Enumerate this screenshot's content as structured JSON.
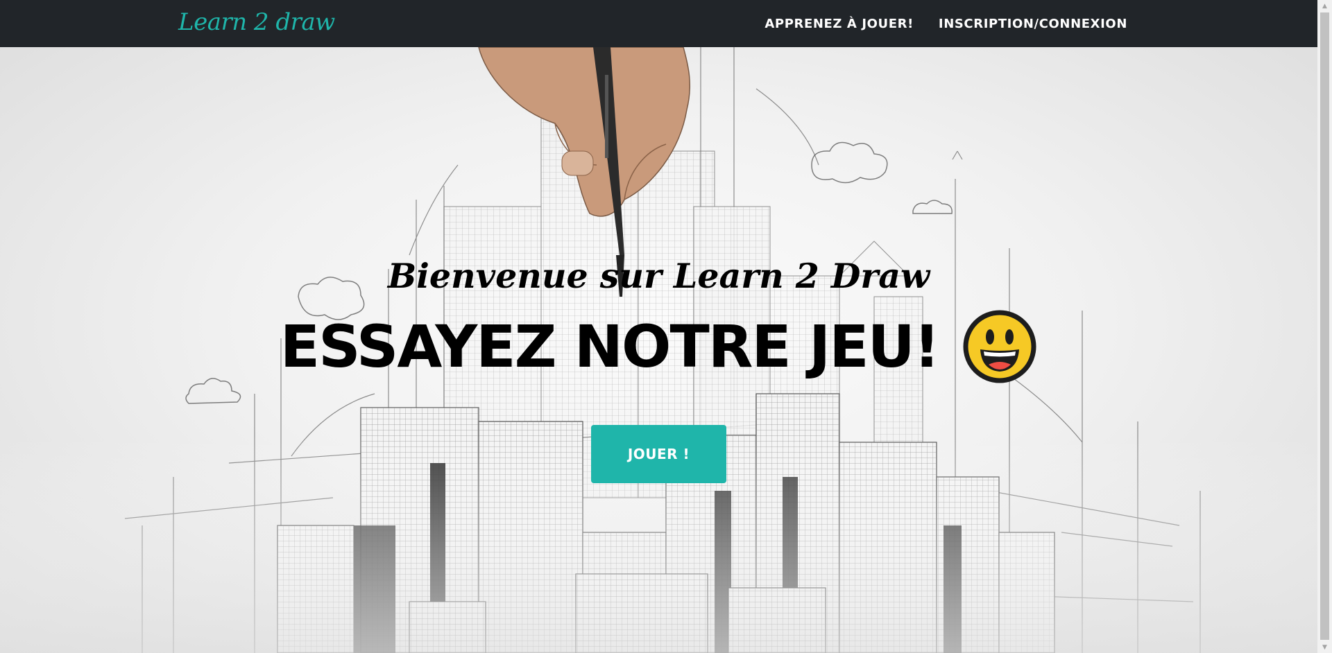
{
  "navbar": {
    "brand": "Learn 2 draw",
    "links": [
      {
        "label": "APPRENEZ À JOUER!"
      },
      {
        "label": "INSCRIPTION/CONNEXION"
      }
    ]
  },
  "hero": {
    "subheading": "Bienvenue sur Learn 2 Draw",
    "heading": "ESSAYEZ NOTRE JEU!",
    "emoji": "grinning-face-icon",
    "button_label": "JOUER !"
  },
  "colors": {
    "accent": "#1fb5aa",
    "navbar_bg": "#212529",
    "emoji_yellow": "#f6c925"
  }
}
